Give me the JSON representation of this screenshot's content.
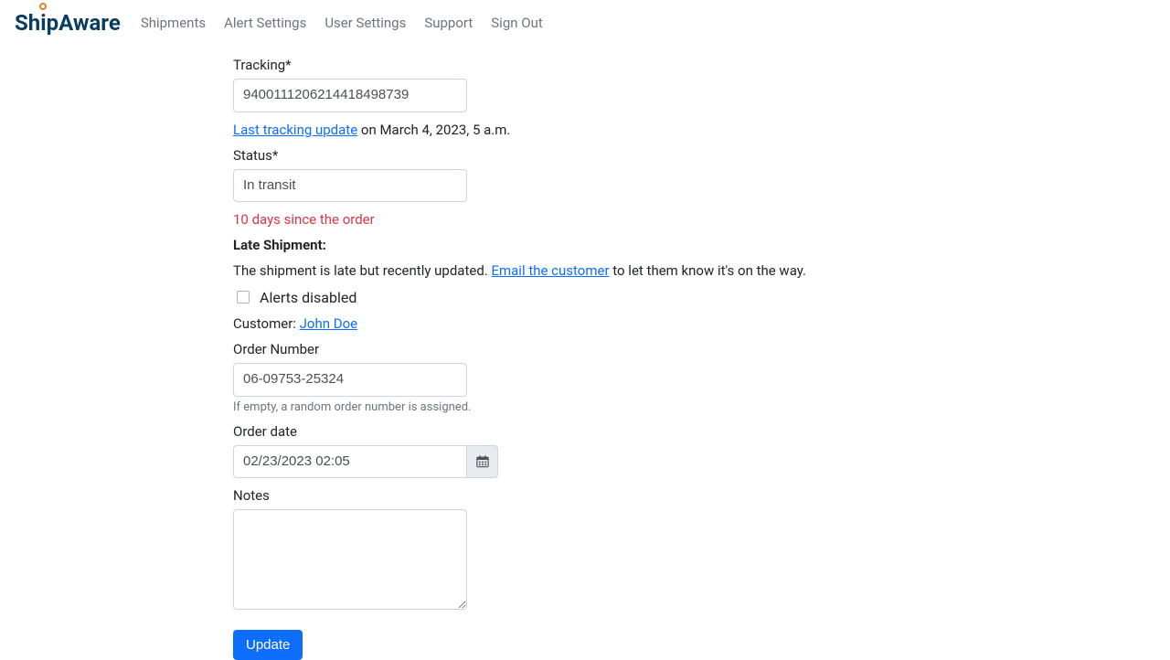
{
  "brand": {
    "ship": "Sh",
    "i": "i",
    "p": "p",
    "aware": "Aware"
  },
  "nav": {
    "shipments": "Shipments",
    "alert_settings": "Alert Settings",
    "user_settings": "User Settings",
    "support": "Support",
    "sign_out": "Sign Out"
  },
  "form": {
    "tracking_label": "Tracking*",
    "tracking_value": "9400111206214418498739",
    "tracking_update_link": "Last tracking update",
    "tracking_update_suffix": " on March 4, 2023, 5 a.m.",
    "status_label": "Status*",
    "status_value": "In transit",
    "days_since": "10 days since the order",
    "late_title": "Late Shipment:",
    "late_prefix": "The shipment is late but recently updated. ",
    "late_link": "Email the customer",
    "late_suffix": " to let them know it's on the way.",
    "alerts_disabled_label": "Alerts disabled",
    "customer_label": "Customer: ",
    "customer_name": "John Doe",
    "order_number_label": "Order Number",
    "order_number_value": "06-09753-25324",
    "order_number_help": "If empty, a random order number is assigned.",
    "order_date_label": "Order date",
    "order_date_value": "02/23/2023 02:05",
    "notes_label": "Notes",
    "notes_value": "",
    "update_button": "Update"
  }
}
